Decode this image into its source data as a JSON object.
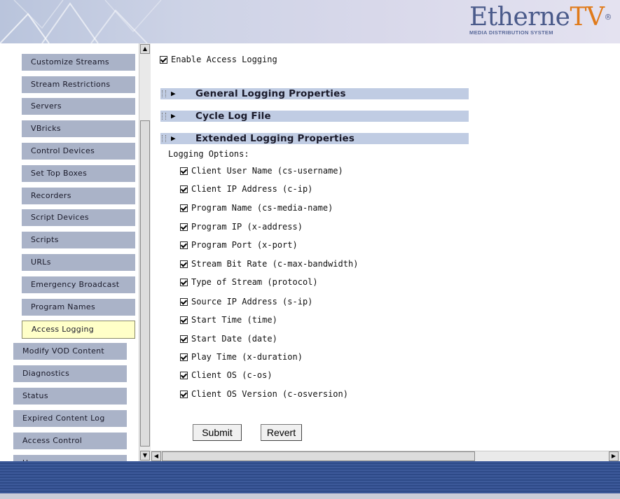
{
  "brand": {
    "name_main": "Etherne",
    "name_accent": "TV",
    "registered": "®",
    "subtitle": "MEDIA DISTRIBUTION SYSTEM",
    "colors": {
      "header_bg": "#cdd3e6",
      "accent": "#e07a1a",
      "nav_button": "#aab3c8",
      "nav_active": "#ffffc8",
      "section_bar": "#c0cce3",
      "footer": "#3d5a9a"
    }
  },
  "sidebar": {
    "sub_items": [
      {
        "label": "Customize Streams"
      },
      {
        "label": "Stream Restrictions"
      },
      {
        "label": "Servers"
      },
      {
        "label": "VBricks"
      },
      {
        "label": "Control Devices"
      },
      {
        "label": "Set Top Boxes"
      },
      {
        "label": "Recorders"
      },
      {
        "label": "Script Devices"
      },
      {
        "label": "Scripts"
      },
      {
        "label": "URLs"
      },
      {
        "label": "Emergency Broadcast"
      },
      {
        "label": "Program Names"
      },
      {
        "label": "Access Logging"
      }
    ],
    "top_items": [
      {
        "label": "Modify VOD Content"
      },
      {
        "label": "Diagnostics"
      },
      {
        "label": "Status"
      },
      {
        "label": "Expired Content Log"
      },
      {
        "label": "Access Control"
      },
      {
        "label": "Users"
      }
    ],
    "active": "Access Logging"
  },
  "main": {
    "enable_label": "Enable Access Logging",
    "sections": [
      {
        "title": "General Logging Properties"
      },
      {
        "title": "Cycle Log File"
      },
      {
        "title": "Extended Logging Properties"
      }
    ],
    "logging_options_label": "Logging Options:",
    "options": [
      {
        "label": "Client User Name (cs-username)"
      },
      {
        "label": "Client IP Address (c-ip)"
      },
      {
        "label": "Program Name (cs-media-name)"
      },
      {
        "label": "Program IP (x-address)"
      },
      {
        "label": "Program Port (x-port)"
      },
      {
        "label": "Stream Bit Rate (c-max-bandwidth)"
      },
      {
        "label": "Type of Stream (protocol)"
      },
      {
        "label": "Source IP Address (s-ip)"
      },
      {
        "label": "Start Time (time)"
      },
      {
        "label": "Start Date (date)"
      },
      {
        "label": "Play Time (x-duration)"
      },
      {
        "label": "Client OS (c-os)"
      },
      {
        "label": "Client OS Version (c-osversion)"
      }
    ],
    "submit_label": "Submit",
    "revert_label": "Revert"
  },
  "scroll_icons": {
    "up": "▲",
    "down": "▼",
    "left": "◀",
    "right": "▶",
    "expand": "▶"
  }
}
